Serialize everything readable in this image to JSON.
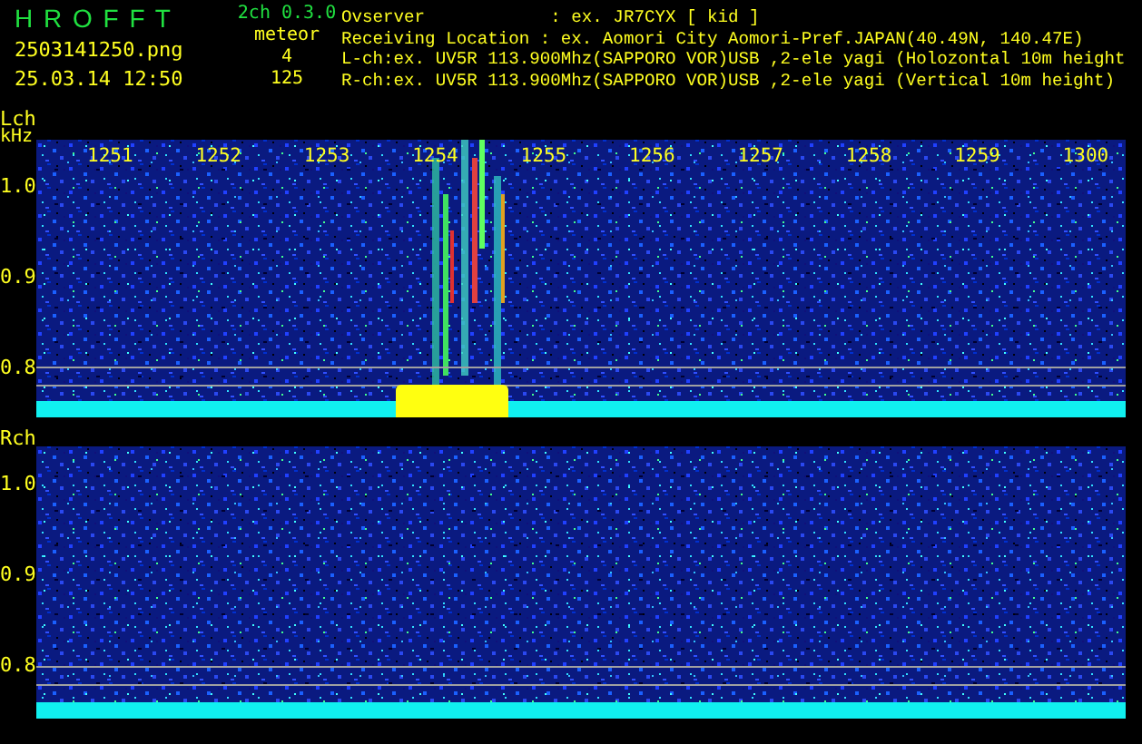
{
  "header": {
    "app_name": "H R O F F T",
    "version": "2ch 0.3.0",
    "filename": "2503141250.png",
    "timestamp": "25.03.14 12:50",
    "mode": "meteor",
    "counts": [
      "4",
      "125"
    ],
    "info_lines": [
      "Ovserver            : ex. JR7CYX [ kid ]",
      "Receiving Location : ex. Aomori City Aomori-Pref.JAPAN(40.49N, 140.47E)",
      "L-ch:ex. UV5R 113.900Mhz(SAPPORO VOR)USB ,2-ele yagi (Holozontal 10m height",
      "R-ch:ex. UV5R 113.900Mhz(SAPPORO VOR)USB ,2-ele yagi (Vertical 10m height)"
    ]
  },
  "panels": [
    {
      "label": "Lch",
      "unit": "kHz",
      "meteor_echo": true,
      "freq_labels": [
        "1251",
        "1252",
        "1253",
        "1254",
        "1255",
        "1256",
        "1257",
        "1258",
        "1259",
        "1300"
      ],
      "y_labels": [
        "1.0",
        "0.9",
        "0.8"
      ]
    },
    {
      "label": "Rch",
      "meteor_echo": false,
      "y_labels": [
        "1.0",
        "0.9",
        "0.8"
      ]
    }
  ]
}
